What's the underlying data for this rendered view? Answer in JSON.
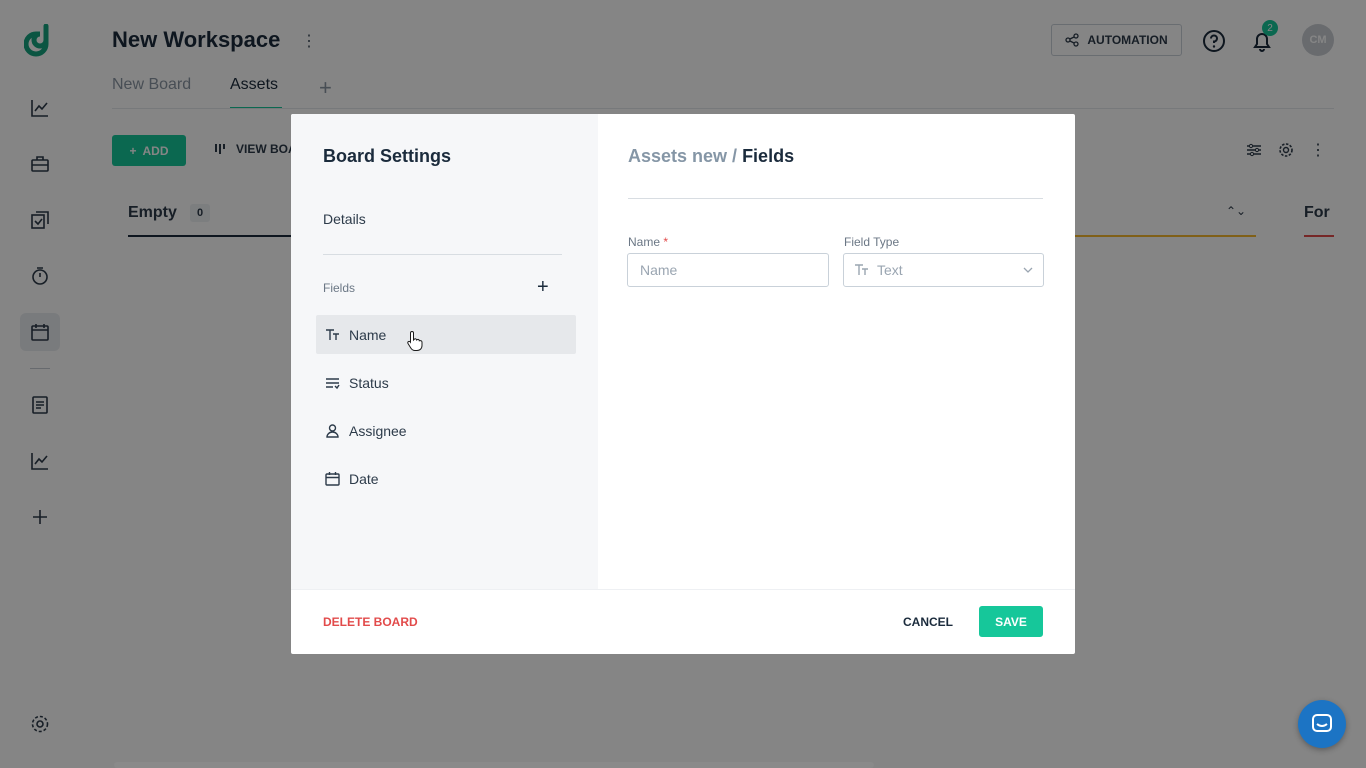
{
  "workspace": {
    "title": "New Workspace"
  },
  "tabs": [
    {
      "label": "New Board"
    },
    {
      "label": "Assets"
    }
  ],
  "toolbar": {
    "add_label": "ADD",
    "view_label": "VIEW BOA"
  },
  "header_right": {
    "automation_label": "AUTOMATION",
    "notification_count": "2",
    "avatar_initials": "CM"
  },
  "columns": {
    "empty_title": "Empty",
    "empty_count": "0",
    "for_title": "For"
  },
  "sidebar": {
    "icons": [
      "chart-icon",
      "briefcase-icon",
      "tasks-icon",
      "timer-icon",
      "calendar-icon",
      "document-icon",
      "chart-icon",
      "plus-icon",
      "settings-icon"
    ]
  },
  "modal": {
    "title": "Board Settings",
    "details_label": "Details",
    "fields_label": "Fields",
    "fields": [
      {
        "label": "Name",
        "icon": "text-type-icon"
      },
      {
        "label": "Status",
        "icon": "status-list-icon"
      },
      {
        "label": "Assignee",
        "icon": "user-icon"
      },
      {
        "label": "Date",
        "icon": "calendar-icon"
      }
    ],
    "breadcrumb_parent": "Assets new /",
    "breadcrumb_current": "Fields",
    "name_label": "Name",
    "name_required": "*",
    "name_placeholder": "Name",
    "field_type_label": "Field Type",
    "field_type_value": "Text",
    "delete_label": "DELETE BOARD",
    "cancel_label": "CANCEL",
    "save_label": "SAVE"
  },
  "colors": {
    "brand": "#16c79a",
    "danger": "#e24b4b",
    "dark": "#1b2b3c"
  }
}
